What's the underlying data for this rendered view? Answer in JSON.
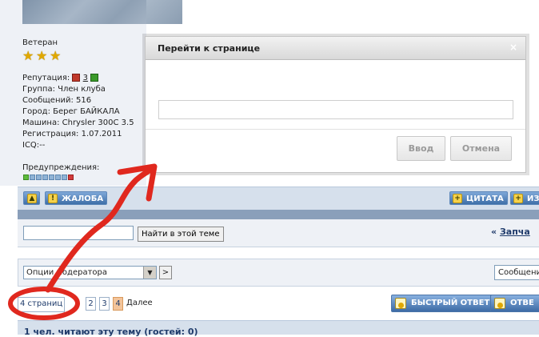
{
  "profile": {
    "rank": "Ветеран",
    "stars": 3,
    "reputation_label": "Репутация:",
    "reputation_value": "3",
    "group": "Группа: Член клуба",
    "posts": "Сообщений: 516",
    "city": "Город: Берег БАЙКАЛА",
    "car": "Машина: Chrysler 300C 3.5",
    "registered": "Регистрация: 1.07.2011",
    "icq": "ICQ:--",
    "warnings_label": "Предупреждения:",
    "warning_level": "1 of 8 (red marked)"
  },
  "post_footer": {
    "complaint_label": "ЖАЛОБА",
    "quote_label": "ЦИТАТА",
    "edit_partial_label": "ИЗ"
  },
  "search": {
    "input_value": "",
    "button_label": "Найти в этой теме",
    "back_link_prefix": "«",
    "back_link_label": "Запча"
  },
  "moderator": {
    "select_value": "Опции модератора",
    "go_label": ">",
    "sort_select_value": "Сообщени"
  },
  "pagination": {
    "pages_label": "4 страниц",
    "pages": [
      "2",
      "3",
      "4"
    ],
    "current_page": "4",
    "next_label": "Далее",
    "quick_reply_label": "БЫСТРЫЙ ОТВЕТ",
    "reply_partial_label": "ОТВЕ"
  },
  "readers": {
    "text": "1 чел. читают эту тему (гостей: 0)"
  },
  "modal": {
    "title": "Перейти к странице",
    "close_glyph": "×",
    "input_value": "",
    "ok_label": "Ввод",
    "cancel_label": "Отмена"
  },
  "colors": {
    "accent_blue": "#3e6fa8",
    "annotation_red": "#e0281e",
    "current_page": "#f3c49a"
  }
}
